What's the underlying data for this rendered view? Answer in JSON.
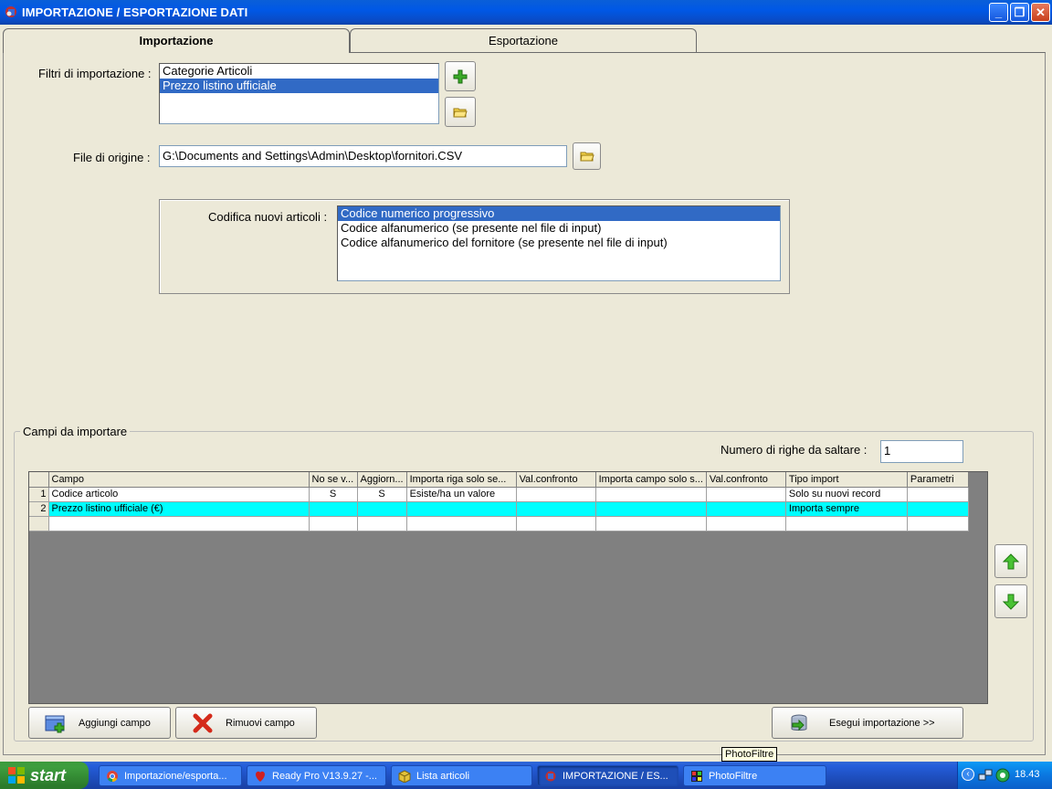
{
  "window": {
    "title": "IMPORTAZIONE / ESPORTAZIONE DATI"
  },
  "tabs": [
    {
      "label": "Importazione",
      "active": true
    },
    {
      "label": "Esportazione",
      "active": false
    }
  ],
  "filters": {
    "label": "Filtri di importazione :",
    "items": [
      {
        "label": "Categorie Articoli",
        "selected": false
      },
      {
        "label": "Prezzo listino ufficiale",
        "selected": true
      }
    ],
    "add_icon": "plus-icon",
    "open_icon": "folder-icon"
  },
  "source_file": {
    "label": "File di origine :",
    "value": "G:\\Documents and Settings\\Admin\\Desktop\\fornitori.CSV",
    "browse_icon": "folder-icon"
  },
  "coding": {
    "label": "Codifica nuovi articoli :",
    "items": [
      {
        "label": "Codice numerico progressivo",
        "selected": true
      },
      {
        "label": "Codice alfanumerico (se presente nel file di input)",
        "selected": false
      },
      {
        "label": "Codice alfanumerico del fornitore (se presente nel file di input)",
        "selected": false
      }
    ]
  },
  "fields_group": {
    "legend": "Campi da importare",
    "skip_rows_label": "Numero di righe da saltare :",
    "skip_rows_value": "1",
    "columns": [
      "Campo",
      "No se v...",
      "Aggiorn...",
      "Importa riga solo se...",
      "Val.confronto",
      "Importa campo solo s...",
      "Val.confronto",
      "Tipo import",
      "Parametri"
    ],
    "rows": [
      {
        "num": "1",
        "cells": [
          "Codice articolo",
          "S",
          "S",
          "Esiste/ha un valore",
          "",
          "",
          "",
          "Solo su nuovi record",
          ""
        ],
        "selected": false
      },
      {
        "num": "2",
        "cells": [
          "Prezzo listino ufficiale (€)",
          "",
          "",
          "",
          "",
          "",
          "",
          "Importa sempre",
          ""
        ],
        "selected": true
      },
      {
        "num": "",
        "cells": [
          "",
          "",
          "",
          "",
          "",
          "",
          "",
          "",
          ""
        ],
        "selected": false
      }
    ],
    "up_icon": "arrow-up-icon",
    "down_icon": "arrow-down-icon"
  },
  "buttons": {
    "add_field": "Aggiungi campo",
    "remove_field": "Rimuovi campo",
    "execute": "Esegui importazione >>"
  },
  "taskbar": {
    "start": "start",
    "items": [
      {
        "label": "Importazione/esporta...",
        "icon": "chrome-icon",
        "active": false
      },
      {
        "label": "Ready Pro V13.9.27 -...",
        "icon": "readypro-icon",
        "active": false
      },
      {
        "label": "Lista articoli",
        "icon": "box-icon",
        "active": false
      },
      {
        "label": "IMPORTAZIONE / ES...",
        "icon": "app-icon",
        "active": true
      },
      {
        "label": "PhotoFiltre",
        "icon": "photofiltre-icon",
        "active": false
      }
    ],
    "tooltip": "PhotoFiltre",
    "clock": "18.43"
  },
  "colors": {
    "titlebar": "#0058e6",
    "selection": "#316ac5",
    "grid_highlight": "#00ffff",
    "grid_background": "#808080"
  }
}
